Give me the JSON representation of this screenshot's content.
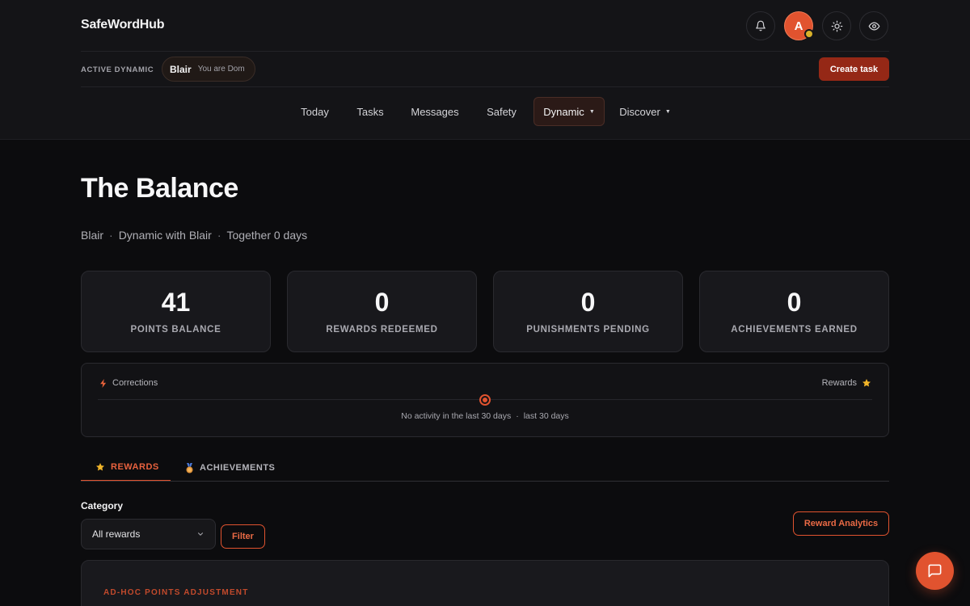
{
  "brand": "SafeWordHub",
  "header": {
    "avatar_initial": "A",
    "active_label": "ACTIVE DYNAMIC",
    "partner_name": "Blair",
    "role_text": "You are Dom",
    "create_task_label": "Create task"
  },
  "nav": {
    "items": [
      {
        "label": "Today"
      },
      {
        "label": "Tasks"
      },
      {
        "label": "Messages"
      },
      {
        "label": "Safety"
      },
      {
        "label": "Dynamic"
      },
      {
        "label": "Discover"
      }
    ],
    "active": "Dynamic"
  },
  "page": {
    "title": "The Balance",
    "subtitle": {
      "partner": "Blair",
      "dynamic": "Dynamic with Blair",
      "together": "Together 0 days"
    }
  },
  "stats": [
    {
      "value": "41",
      "label": "POINTS BALANCE"
    },
    {
      "value": "0",
      "label": "REWARDS REDEEMED"
    },
    {
      "value": "0",
      "label": "PUNISHMENTS PENDING"
    },
    {
      "value": "0",
      "label": "ACHIEVEMENTS EARNED"
    }
  ],
  "balance": {
    "left_label": "Corrections",
    "right_label": "Rewards",
    "message": "No activity in the last 30 days",
    "period": "last 30 days"
  },
  "tabs": [
    {
      "label": "REWARDS",
      "icon": "star-icon",
      "active": true
    },
    {
      "label": "ACHIEVEMENTS",
      "icon": "medal-icon",
      "active": false
    }
  ],
  "filters": {
    "category_label": "Category",
    "category_value": "All rewards",
    "filter_label": "Filter",
    "analytics_label": "Reward Analytics"
  },
  "panel": {
    "section_title": "AD-HOC POINTS ADJUSTMENT"
  },
  "colors": {
    "accent": "#e1532f",
    "button_dark": "#952816",
    "star": "#f0b429",
    "bolt": "#e8623a"
  }
}
